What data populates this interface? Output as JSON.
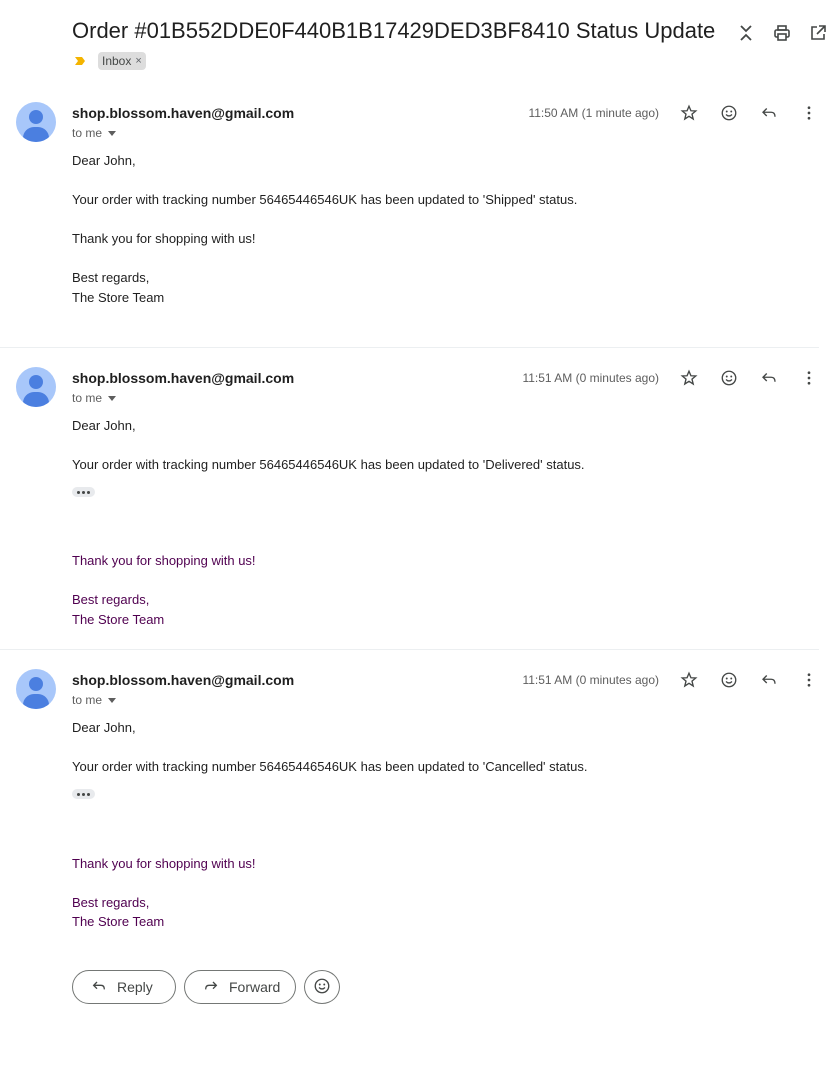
{
  "subject": "Order #01B552DDE0F440B1B17429DED3BF8410 Status Update",
  "labels": [
    {
      "name": "Inbox",
      "remove": "×"
    }
  ],
  "top_icons": [
    "expand-collapse-icon",
    "print-icon",
    "open-in-new-window-icon"
  ],
  "messages": [
    {
      "sender": "shop.blossom.haven@gmail.com",
      "to": "to me",
      "time": "11:50 AM (1 minute ago)",
      "greeting": "Dear John,",
      "body": "Your order with tracking number 56465446546UK has been updated to 'Shipped' status.",
      "thanks": "Thank you for shopping with us!",
      "regards": "Best regards,",
      "team": "The Store Team"
    },
    {
      "sender": "shop.blossom.haven@gmail.com",
      "to": "to me",
      "time": "11:51 AM (0 minutes ago)",
      "greeting": "Dear John,",
      "body": "Your order with tracking number 56465446546UK has been updated to 'Delivered' status.",
      "thanks": "Thank you for shopping with us!",
      "regards": "Best regards,",
      "team": "The Store Team"
    },
    {
      "sender": "shop.blossom.haven@gmail.com",
      "to": "to me",
      "time": "11:51 AM (0 minutes ago)",
      "greeting": "Dear John,",
      "body": "Your order with tracking number 56465446546UK has been updated to 'Cancelled' status.",
      "thanks": "Thank you for shopping with us!",
      "regards": "Best regards,",
      "team": "The Store Team"
    }
  ],
  "message_actions": [
    "star-icon",
    "emoji-react-icon",
    "reply-icon",
    "more-options-icon"
  ],
  "footer": {
    "reply_label": "Reply",
    "forward_label": "Forward"
  },
  "colors": {
    "quoted_text": "#500050",
    "avatar_bg": "#a8c7fa",
    "avatar_fg": "#4b7fe0",
    "label_chip": "#dddddd",
    "importance": "#f4b400"
  }
}
